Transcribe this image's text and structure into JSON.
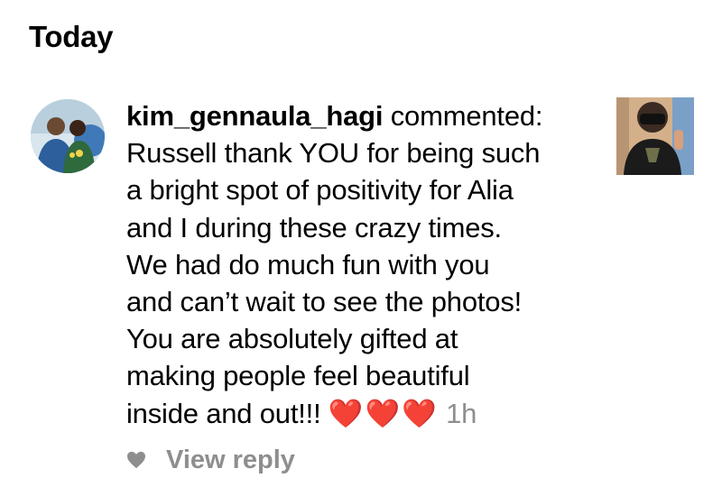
{
  "section": {
    "title": "Today"
  },
  "notification": {
    "username": "kim_gennaula_hagi",
    "action": "commented:",
    "lines": [
      "Russell thank YOU for being such",
      "a bright spot of positivity for Alia",
      "and I during these crazy times.",
      "We had do much fun with you",
      "and can’t wait to see the photos!",
      "You are absolutely gifted at",
      "making people feel beautiful",
      "inside and out!!!"
    ],
    "hearts": "❤️❤️❤️",
    "time": "1h"
  },
  "reply": {
    "label": "View reply"
  },
  "icons": {
    "like": "heart-icon",
    "avatar": "profile-avatar",
    "thumbnail": "post-thumbnail"
  },
  "colors": {
    "heart": "#e0201f",
    "muted": "#8e8e8e",
    "text": "#000000"
  }
}
